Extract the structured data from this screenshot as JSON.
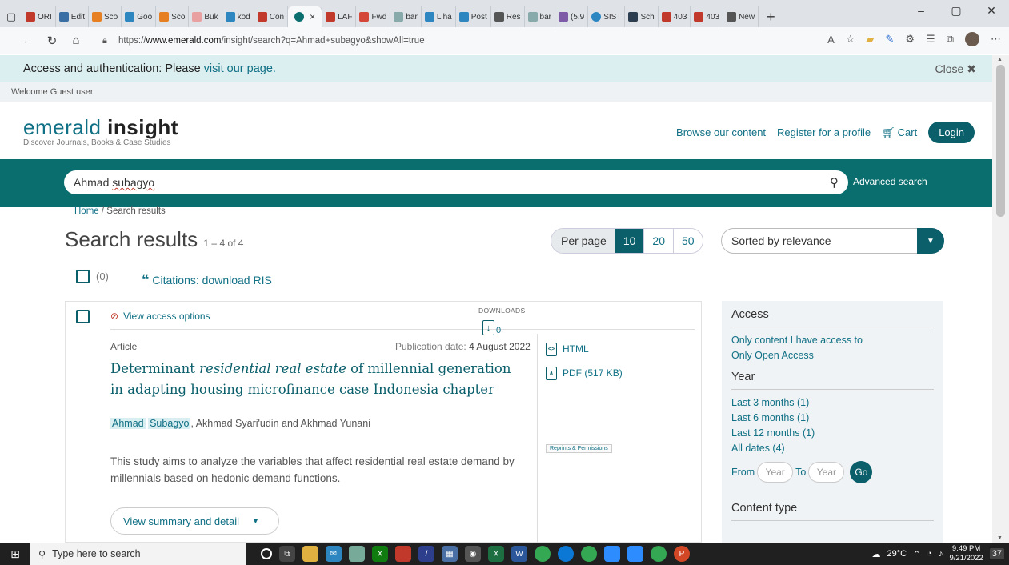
{
  "browser": {
    "tabs": [
      "ORI",
      "Edit",
      "Sco",
      "Goo",
      "Sco",
      "Buk",
      "kod",
      "Con",
      "LAF",
      "Fwd",
      "bar",
      "Liha",
      "Post",
      "Res",
      "bar",
      "(5.9",
      "SIST",
      "Sch",
      "403",
      "403",
      "New"
    ],
    "active_tab_close": "×",
    "new_tab": "+",
    "url_prefix": "https://",
    "url_host": "www.emerald.com",
    "url_path": "/insight/search?q=Ahmad+subagyo&showAll=true"
  },
  "notice": {
    "text": "Access and authentication: Please",
    "link": "visit our page.",
    "close": "Close"
  },
  "welcome": "Welcome Guest user",
  "header": {
    "brand_light": "emerald",
    "brand_bold": "insight",
    "tagline": "Discover Journals, Books & Case Studies",
    "nav": [
      "Browse our content",
      "Register for a profile"
    ],
    "cart": "Cart",
    "login": "Login"
  },
  "search": {
    "first": "Ahmad",
    "second": "subagyo",
    "advanced": "Advanced search"
  },
  "breadcrumb": {
    "home": "Home",
    "sep": "/",
    "current": "Search results"
  },
  "results": {
    "title": "Search results",
    "range": "1 – 4 of 4",
    "per_page_label": "Per page",
    "per_page_options": [
      "10",
      "20",
      "50"
    ],
    "per_page_selected": "10",
    "sort": "Sorted by relevance",
    "selected_count": "(0)",
    "citations": "Citations: download RIS"
  },
  "card": {
    "access": "View access options",
    "type": "Article",
    "pubdate_label": "Publication date:",
    "pubdate": "4 August 2022",
    "title_a": "Determinant",
    "title_em": "residential real estate",
    "title_b": "of millennial generation in adapting housing microfinance case Indonesia chapter",
    "author_first": "Ahmad",
    "author_last": "Subagyo",
    "authors_rest": ", Akhmad Syari'udin and Akhmad Yunani",
    "abstract": "This study aims to analyze the variables that affect residential real estate demand by millennials based on hedonic demand functions.",
    "view_summary": "View summary and detail",
    "html": "HTML",
    "pdf": "PDF (517 KB)",
    "reprints": "Reprints & Permissions",
    "downloads_label": "DOWNLOADS",
    "downloads": "0"
  },
  "facets": {
    "access_title": "Access",
    "access_items": [
      "Only content I have access to",
      "Only Open Access"
    ],
    "year_title": "Year",
    "year_items": [
      "Last 3 months (1)",
      "Last 6 months (1)",
      "Last 12 months (1)",
      "All dates (4)"
    ],
    "from": "From",
    "to": "To",
    "year_placeholder": "Year",
    "go": "Go",
    "content_type_title": "Content type"
  },
  "taskbar": {
    "search_placeholder": "Type here to search",
    "weather": "29°C",
    "time": "9:49 PM",
    "date": "9/21/2022",
    "notif": "37"
  },
  "colors": {
    "teal": "#0a6e6e",
    "teal_dark": "#0a5f6b",
    "link": "#107085"
  }
}
